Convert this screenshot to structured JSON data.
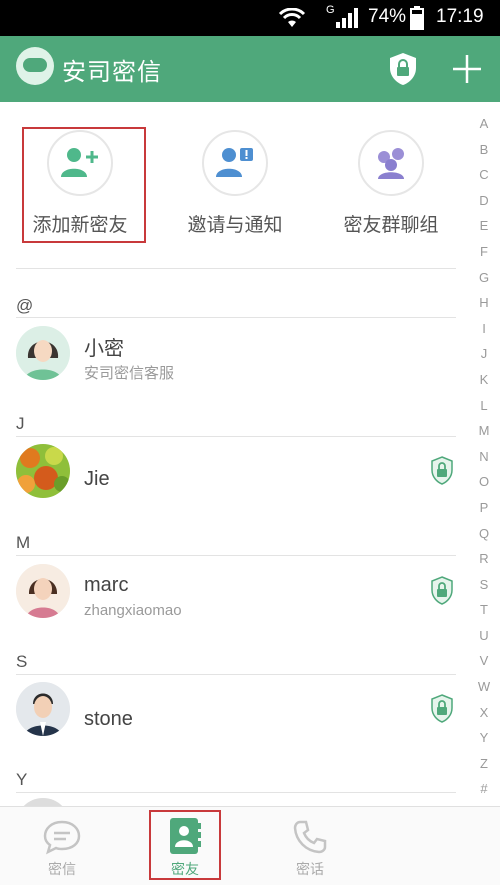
{
  "status_bar": {
    "network": "G",
    "battery": "74%",
    "time": "17:19"
  },
  "header": {
    "title": "安司密信"
  },
  "quick_actions": [
    {
      "label": "添加新密友",
      "icon": "add-friend-icon"
    },
    {
      "label": "邀请与通知",
      "icon": "invite-notify-icon"
    },
    {
      "label": "密友群聊组",
      "icon": "group-chat-icon"
    }
  ],
  "sections": [
    {
      "letter": "@",
      "contacts": [
        {
          "name": "小密",
          "subtitle": "安司密信客服",
          "secure": false
        }
      ]
    },
    {
      "letter": "J",
      "contacts": [
        {
          "name": "Jie",
          "subtitle": "",
          "secure": true
        }
      ]
    },
    {
      "letter": "M",
      "contacts": [
        {
          "name": "marc",
          "subtitle": "zhangxiaomao",
          "secure": true
        }
      ]
    },
    {
      "letter": "S",
      "contacts": [
        {
          "name": "stone",
          "subtitle": "",
          "secure": true
        }
      ]
    },
    {
      "letter": "Y",
      "contacts": []
    }
  ],
  "alphabet_index": [
    "A",
    "B",
    "C",
    "D",
    "E",
    "F",
    "G",
    "H",
    "I",
    "J",
    "K",
    "L",
    "M",
    "N",
    "O",
    "P",
    "Q",
    "R",
    "S",
    "T",
    "U",
    "V",
    "W",
    "X",
    "Y",
    "Z",
    "#"
  ],
  "bottom_nav": [
    {
      "label": "密信",
      "icon": "chat-bubble-icon",
      "active": false
    },
    {
      "label": "密友",
      "icon": "contacts-icon",
      "active": true
    },
    {
      "label": "密话",
      "icon": "phone-icon",
      "active": false
    }
  ],
  "colors": {
    "brand_green": "#4fa87b",
    "highlight_red": "#c8393b",
    "divider": "#e3e3e3"
  }
}
